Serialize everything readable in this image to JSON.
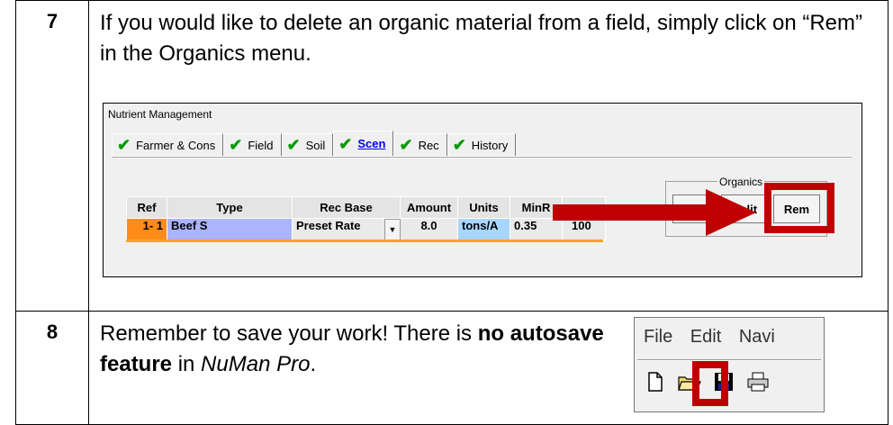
{
  "step7": {
    "number": "7",
    "text": "If you would like to delete an organic material from a field, simply click on “Rem” in the Organics menu."
  },
  "nutrient_window": {
    "title": "Nutrient Management",
    "tabs": [
      {
        "label": "Farmer & Cons"
      },
      {
        "label": "Field"
      },
      {
        "label": "Soil"
      },
      {
        "label": "Scen"
      },
      {
        "label": "Rec"
      },
      {
        "label": "History"
      }
    ],
    "grid": {
      "headers": [
        "Ref",
        "Type",
        "Rec Base",
        "Amount",
        "Units",
        "MinR",
        ""
      ],
      "row": {
        "ref": "1- 1",
        "type": "Beef S",
        "rec_base": "Preset Rate",
        "amount": "8.0",
        "units": "tons/A",
        "minr": "0.35",
        "extra": "100"
      }
    },
    "organics": {
      "legend": "Organics",
      "buttons": [
        "App",
        "Split",
        "Rem"
      ]
    },
    "colors": {
      "highlight": "#c00000",
      "checkmark": "#0a9a0a",
      "active_tab": "#0000ff"
    }
  },
  "step8": {
    "number": "8",
    "text_before": "Remember to save your work! There is ",
    "text_bold": "no autosave feature",
    "text_middle": " in ",
    "text_italic": "NuMan Pro",
    "text_after": "."
  },
  "toolbar_window": {
    "menus": [
      "File",
      "Edit",
      "Navi"
    ],
    "icons": [
      "new-file-icon",
      "open-folder-icon",
      "save-disk-icon",
      "print-icon"
    ]
  }
}
